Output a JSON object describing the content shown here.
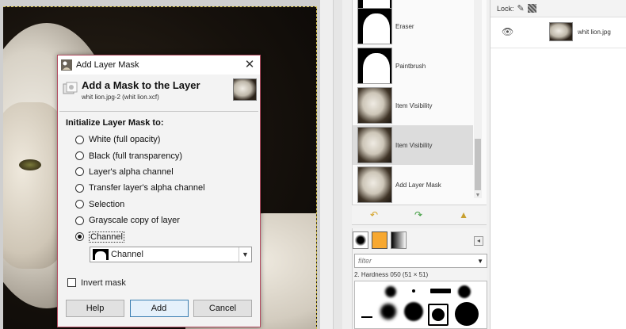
{
  "dialog": {
    "title": "Add Layer Mask",
    "heading": "Add a Mask to the Layer",
    "subtitle": "whit lion.jpg-2 (whit lion.xcf)",
    "section_label": "Initialize Layer Mask to:",
    "options": [
      {
        "label": "White (full opacity)",
        "checked": false
      },
      {
        "label": "Black (full transparency)",
        "checked": false
      },
      {
        "label": "Layer's alpha channel",
        "checked": false
      },
      {
        "label": "Transfer layer's alpha channel",
        "checked": false
      },
      {
        "label": "Selection",
        "checked": false
      },
      {
        "label": "Grayscale copy of layer",
        "checked": false
      },
      {
        "label": "Channel",
        "checked": true
      }
    ],
    "channel_select_value": "Channel",
    "invert_label": "Invert mask",
    "invert_checked": false,
    "buttons": {
      "help": "Help",
      "add": "Add",
      "cancel": "Cancel"
    },
    "close_glyph": "✕"
  },
  "history": {
    "items": [
      {
        "label": "Eraser",
        "thumb": "mask",
        "selected": false
      },
      {
        "label": "Paintbrush",
        "thumb": "mask",
        "selected": false
      },
      {
        "label": "Item Visibility",
        "thumb": "photo",
        "selected": false
      },
      {
        "label": "Item Visibility",
        "thumb": "photo",
        "selected": true
      },
      {
        "label": "Add Layer Mask",
        "thumb": "photo",
        "selected": false
      }
    ],
    "actions": {
      "undo_icon": "undo-icon",
      "redo_icon": "redo-icon",
      "clear_icon": "clear-history-icon"
    }
  },
  "brushes": {
    "filter_placeholder": "filter",
    "brush_name": "2. Hardness 050 (51 × 51)",
    "colors": {
      "foreground": "#f7a830"
    }
  },
  "layers": {
    "lock_label": "Lock:",
    "layer_name": "whit lion.jpg",
    "visible": true
  },
  "colors": {
    "dialog_border": "#b24b5f",
    "canvas_boundary": "#d8c24a",
    "selected_row": "#dcdcdc"
  }
}
